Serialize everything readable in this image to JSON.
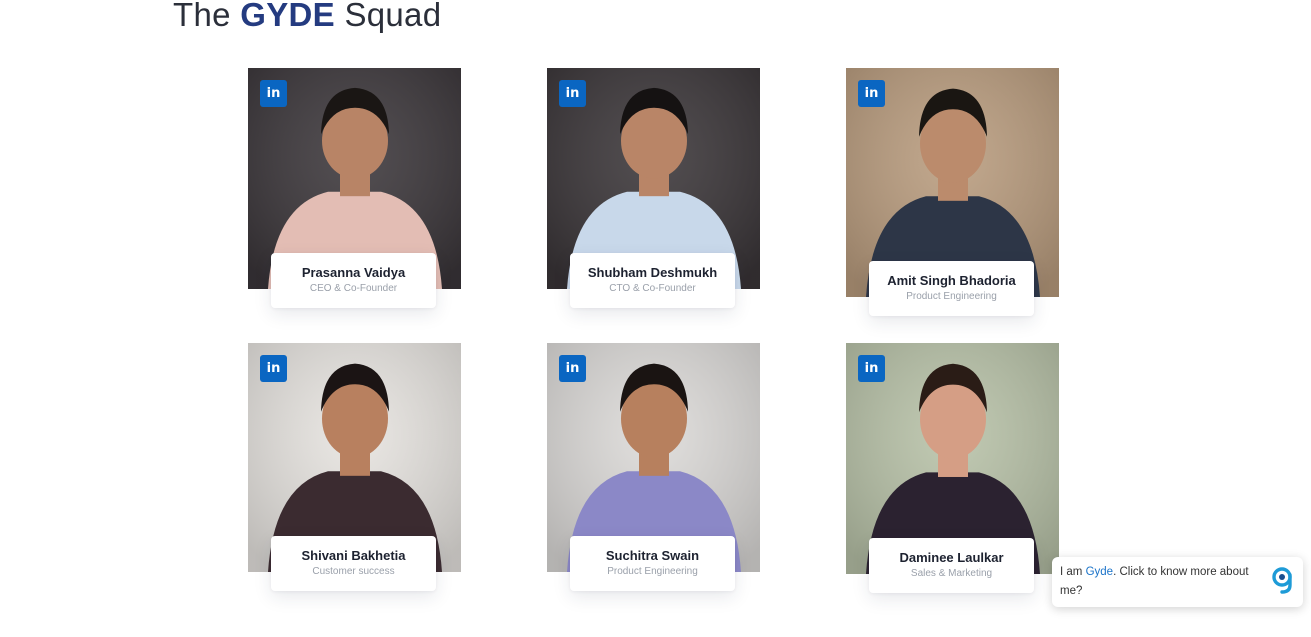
{
  "heading": {
    "prefix": "The",
    "brand": "GYDE",
    "suffix": "Squad"
  },
  "team": [
    {
      "name": "Prasanna Vaidya",
      "role": "CEO & Co-Founder",
      "linkedin_icon": "in",
      "bg": "#3b363a",
      "skin": "#b88466",
      "shirt": "#e3bdb4",
      "hair": "#1a1614"
    },
    {
      "name": "Shubham Deshmukh",
      "role": "CTO & Co-Founder",
      "linkedin_icon": "in",
      "bg": "#3a3538",
      "skin": "#b98567",
      "shirt": "#c8d8ea",
      "hair": "#151212"
    },
    {
      "name": "Amit Singh Bhadoria",
      "role": "Product Engineering",
      "linkedin_icon": "in",
      "bg": "#b99c7e",
      "skin": "#bb8b6c",
      "shirt": "#2d3647",
      "hair": "#1a1612"
    },
    {
      "name": "Shivani Bakhetia",
      "role": "Customer success",
      "linkedin_icon": "in",
      "bg": "#e7e4e0",
      "skin": "#b8805f",
      "shirt": "#3b2b30",
      "hair": "#1b1414"
    },
    {
      "name": "Suchitra Swain",
      "role": "Product Engineering",
      "linkedin_icon": "in",
      "bg": "#dcdad8",
      "skin": "#b7805e",
      "shirt": "#8b88c7",
      "hair": "#1a1412"
    },
    {
      "name": "Daminee Laulkar",
      "role": "Sales & Marketing",
      "linkedin_icon": "in",
      "bg": "#b8c2a8",
      "skin": "#d59e85",
      "shirt": "#2b2230",
      "hair": "#2a1c16"
    }
  ],
  "chat": {
    "text_before": "I am ",
    "brand": "Gyde",
    "text_after": ". Click to know more about me?",
    "logo": "g"
  }
}
